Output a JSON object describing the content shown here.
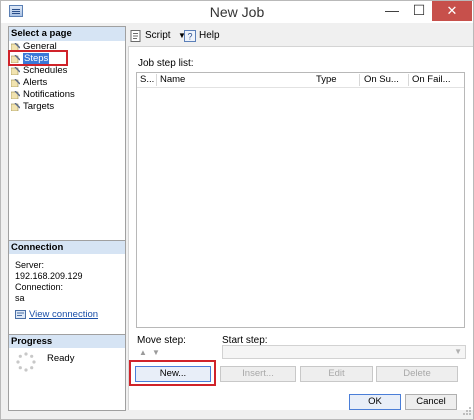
{
  "window": {
    "title": "New Job",
    "minimize_glyph": "—",
    "maximize_glyph": "☐",
    "close_glyph": "✕"
  },
  "left_pane": {
    "select_page_header": "Select a page",
    "pages": [
      {
        "label": "General",
        "icon": "wrench-page-icon"
      },
      {
        "label": "Steps",
        "icon": "wrench-page-icon",
        "selected": true
      },
      {
        "label": "Schedules",
        "icon": "wrench-page-icon"
      },
      {
        "label": "Alerts",
        "icon": "wrench-page-icon"
      },
      {
        "label": "Notifications",
        "icon": "wrench-page-icon"
      },
      {
        "label": "Targets",
        "icon": "wrench-page-icon"
      }
    ],
    "connection": {
      "header": "Connection",
      "server_label": "Server:",
      "server_value": "192.168.209.129",
      "connection_label": "Connection:",
      "connection_value": "sa",
      "view_link": "View connection"
    },
    "progress": {
      "header": "Progress",
      "status": "Ready"
    }
  },
  "toolbar": {
    "script_label": "Script",
    "help_label": "Help"
  },
  "main": {
    "job_step_list_label": "Job step list:",
    "columns": [
      "S...",
      "Name",
      "Type",
      "On Su...",
      "On Fail..."
    ],
    "move_step_label": "Move step:",
    "start_step_label": "Start step:",
    "buttons": {
      "new": "New...",
      "insert": "Insert...",
      "edit": "Edit",
      "delete": "Delete"
    }
  },
  "footer": {
    "ok": "OK",
    "cancel": "Cancel"
  },
  "colors": {
    "highlight_red": "#d0232a",
    "section_header": "#d6e4f4",
    "selection_blue": "#3a78d8",
    "close_red": "#c7504b"
  }
}
